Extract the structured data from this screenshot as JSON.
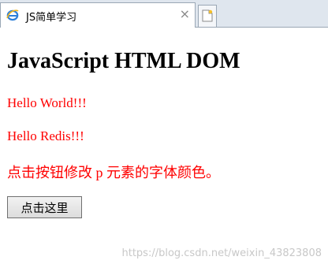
{
  "browser": {
    "tab_title": "JS简单学习",
    "tab_close": "×",
    "tab_icon": "ie-logo-icon",
    "newtab_icon": "new-tab-icon"
  },
  "page": {
    "heading": "JavaScript HTML DOM",
    "paragraphs": [
      "Hello World!!!",
      "Hello Redis!!!",
      "点击按钮修改 p 元素的字体颜色。"
    ],
    "button_label": "点击这里",
    "text_color": "#ff0000"
  },
  "watermark": "https://blog.csdn.net/weixin_43823808"
}
